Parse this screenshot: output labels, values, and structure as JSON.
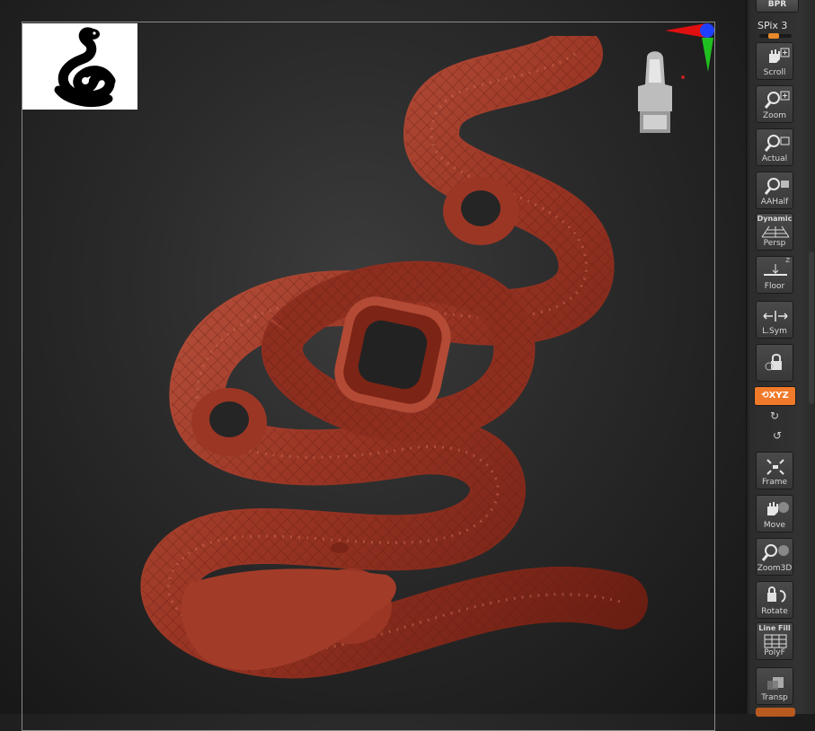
{
  "shelf": {
    "bpr_label": "BPR",
    "spix_label": "SPix 3",
    "buttons": [
      {
        "label": "Scroll",
        "icon": "hand-icon"
      },
      {
        "label": "Zoom",
        "icon": "magnifier-icon"
      },
      {
        "label": "Actual",
        "icon": "magnifier-icon"
      },
      {
        "label": "AAHalf",
        "icon": "magnifier-icon"
      },
      {
        "label": "Persp",
        "top": "Dynamic",
        "icon": "grid-icon"
      },
      {
        "label": "Floor",
        "icon": "floor-icon"
      },
      {
        "label": "L.Sym",
        "icon": "symmetry-icon"
      },
      {
        "label": "",
        "icon": "lock-icon"
      },
      {
        "label": "Frame",
        "icon": "frame-icon"
      },
      {
        "label": "Move",
        "icon": "hand-icon"
      },
      {
        "label": "Zoom3D",
        "icon": "magnifier-icon"
      },
      {
        "label": "Rotate",
        "icon": "rotate-icon"
      },
      {
        "label": "PolyF",
        "top": "Line Fill",
        "icon": "polyframe-icon"
      },
      {
        "label": "Transp",
        "icon": "transparency-icon"
      }
    ],
    "xyz_label": "XYZ",
    "floor_axis_label": "Z"
  },
  "colors": {
    "model": "#8f2c1e",
    "model_highlight": "#c65a44",
    "accent": "#f07a2a",
    "axis_x": "#e01010",
    "axis_y": "#20c020",
    "axis_z": "#2040ff"
  }
}
